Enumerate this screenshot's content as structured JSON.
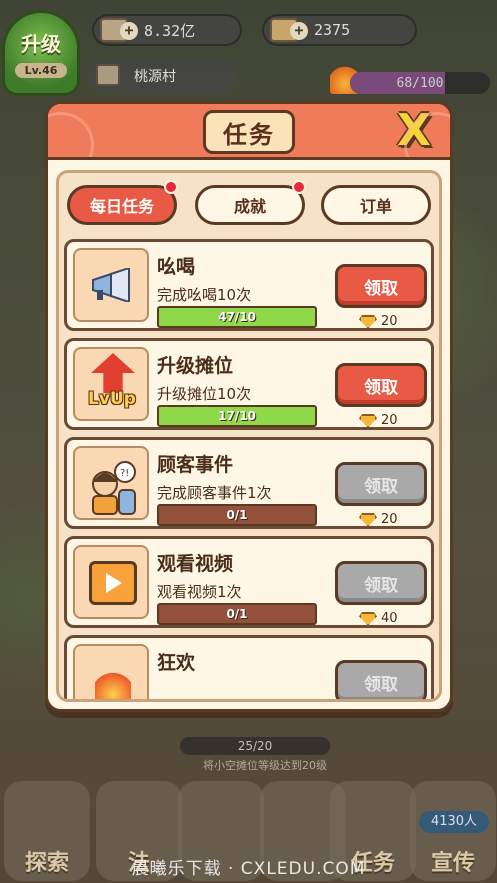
{
  "hud": {
    "level_label": "升级",
    "level_value": "Lv.46",
    "coins": "8.32亿",
    "gems": "2375",
    "location": "桃源村",
    "energy": "68/100",
    "energy_fraction": 0.68
  },
  "bottom_hud": {
    "stall_progress": "25/20",
    "stall_hint": "将小空摊位等级达到20级",
    "visitors": "4130人",
    "buttons": [
      "探索",
      "法",
      "",
      "",
      "任务",
      "宣传"
    ]
  },
  "watermark": "晨曦乐下载 · CXLEDU.COM",
  "modal": {
    "title": "任务",
    "close_label": "X",
    "tabs": [
      {
        "label": "每日任务",
        "active": true,
        "dot": true
      },
      {
        "label": "成就",
        "active": false,
        "dot": true
      },
      {
        "label": "订单",
        "active": false,
        "dot": false
      }
    ],
    "tasks": [
      {
        "name": "吆喝",
        "desc": "完成吆喝10次",
        "progress_text": "47/10",
        "progress": 1.0,
        "claim": "领取",
        "claimable": true,
        "reward": "20",
        "icon": "megaphone-icon"
      },
      {
        "name": "升级摊位",
        "desc": "升级摊位10次",
        "progress_text": "17/10",
        "progress": 1.0,
        "claim": "领取",
        "claimable": true,
        "reward": "20",
        "icon": "lvup-icon"
      },
      {
        "name": "顾客事件",
        "desc": "完成顾客事件1次",
        "progress_text": "0/1",
        "progress": 0.0,
        "claim": "领取",
        "claimable": false,
        "reward": "20",
        "icon": "customer-icon"
      },
      {
        "name": "观看视频",
        "desc": "观看视频1次",
        "progress_text": "0/1",
        "progress": 0.0,
        "claim": "领取",
        "claimable": false,
        "reward": "40",
        "icon": "video-icon"
      },
      {
        "name": "狂欢",
        "desc": "",
        "progress_text": "",
        "progress": 0.0,
        "claim": "领取",
        "claimable": false,
        "reward": "",
        "icon": "fire-icon"
      }
    ]
  },
  "colors": {
    "accent": "#e85a45",
    "header": "#f07b5b",
    "progress_fill": "#8fd84a",
    "progress_empty": "#93503b",
    "disabled": "#a9a9a9"
  }
}
